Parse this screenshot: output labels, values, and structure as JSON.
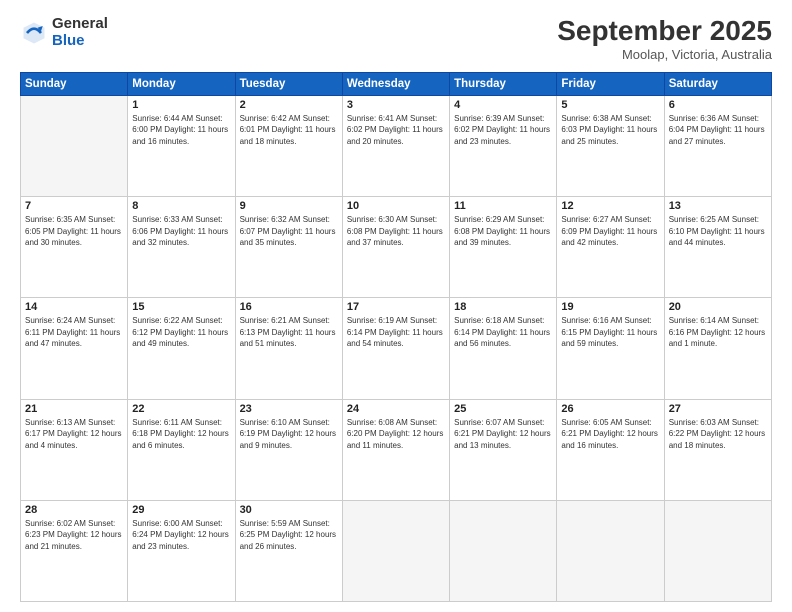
{
  "logo": {
    "general": "General",
    "blue": "Blue"
  },
  "header": {
    "month_title": "September 2025",
    "location": "Moolap, Victoria, Australia"
  },
  "weekdays": [
    "Sunday",
    "Monday",
    "Tuesday",
    "Wednesday",
    "Thursday",
    "Friday",
    "Saturday"
  ],
  "weeks": [
    [
      {
        "day": "",
        "info": ""
      },
      {
        "day": "1",
        "info": "Sunrise: 6:44 AM\nSunset: 6:00 PM\nDaylight: 11 hours\nand 16 minutes."
      },
      {
        "day": "2",
        "info": "Sunrise: 6:42 AM\nSunset: 6:01 PM\nDaylight: 11 hours\nand 18 minutes."
      },
      {
        "day": "3",
        "info": "Sunrise: 6:41 AM\nSunset: 6:02 PM\nDaylight: 11 hours\nand 20 minutes."
      },
      {
        "day": "4",
        "info": "Sunrise: 6:39 AM\nSunset: 6:02 PM\nDaylight: 11 hours\nand 23 minutes."
      },
      {
        "day": "5",
        "info": "Sunrise: 6:38 AM\nSunset: 6:03 PM\nDaylight: 11 hours\nand 25 minutes."
      },
      {
        "day": "6",
        "info": "Sunrise: 6:36 AM\nSunset: 6:04 PM\nDaylight: 11 hours\nand 27 minutes."
      }
    ],
    [
      {
        "day": "7",
        "info": "Sunrise: 6:35 AM\nSunset: 6:05 PM\nDaylight: 11 hours\nand 30 minutes."
      },
      {
        "day": "8",
        "info": "Sunrise: 6:33 AM\nSunset: 6:06 PM\nDaylight: 11 hours\nand 32 minutes."
      },
      {
        "day": "9",
        "info": "Sunrise: 6:32 AM\nSunset: 6:07 PM\nDaylight: 11 hours\nand 35 minutes."
      },
      {
        "day": "10",
        "info": "Sunrise: 6:30 AM\nSunset: 6:08 PM\nDaylight: 11 hours\nand 37 minutes."
      },
      {
        "day": "11",
        "info": "Sunrise: 6:29 AM\nSunset: 6:08 PM\nDaylight: 11 hours\nand 39 minutes."
      },
      {
        "day": "12",
        "info": "Sunrise: 6:27 AM\nSunset: 6:09 PM\nDaylight: 11 hours\nand 42 minutes."
      },
      {
        "day": "13",
        "info": "Sunrise: 6:25 AM\nSunset: 6:10 PM\nDaylight: 11 hours\nand 44 minutes."
      }
    ],
    [
      {
        "day": "14",
        "info": "Sunrise: 6:24 AM\nSunset: 6:11 PM\nDaylight: 11 hours\nand 47 minutes."
      },
      {
        "day": "15",
        "info": "Sunrise: 6:22 AM\nSunset: 6:12 PM\nDaylight: 11 hours\nand 49 minutes."
      },
      {
        "day": "16",
        "info": "Sunrise: 6:21 AM\nSunset: 6:13 PM\nDaylight: 11 hours\nand 51 minutes."
      },
      {
        "day": "17",
        "info": "Sunrise: 6:19 AM\nSunset: 6:14 PM\nDaylight: 11 hours\nand 54 minutes."
      },
      {
        "day": "18",
        "info": "Sunrise: 6:18 AM\nSunset: 6:14 PM\nDaylight: 11 hours\nand 56 minutes."
      },
      {
        "day": "19",
        "info": "Sunrise: 6:16 AM\nSunset: 6:15 PM\nDaylight: 11 hours\nand 59 minutes."
      },
      {
        "day": "20",
        "info": "Sunrise: 6:14 AM\nSunset: 6:16 PM\nDaylight: 12 hours\nand 1 minute."
      }
    ],
    [
      {
        "day": "21",
        "info": "Sunrise: 6:13 AM\nSunset: 6:17 PM\nDaylight: 12 hours\nand 4 minutes."
      },
      {
        "day": "22",
        "info": "Sunrise: 6:11 AM\nSunset: 6:18 PM\nDaylight: 12 hours\nand 6 minutes."
      },
      {
        "day": "23",
        "info": "Sunrise: 6:10 AM\nSunset: 6:19 PM\nDaylight: 12 hours\nand 9 minutes."
      },
      {
        "day": "24",
        "info": "Sunrise: 6:08 AM\nSunset: 6:20 PM\nDaylight: 12 hours\nand 11 minutes."
      },
      {
        "day": "25",
        "info": "Sunrise: 6:07 AM\nSunset: 6:21 PM\nDaylight: 12 hours\nand 13 minutes."
      },
      {
        "day": "26",
        "info": "Sunrise: 6:05 AM\nSunset: 6:21 PM\nDaylight: 12 hours\nand 16 minutes."
      },
      {
        "day": "27",
        "info": "Sunrise: 6:03 AM\nSunset: 6:22 PM\nDaylight: 12 hours\nand 18 minutes."
      }
    ],
    [
      {
        "day": "28",
        "info": "Sunrise: 6:02 AM\nSunset: 6:23 PM\nDaylight: 12 hours\nand 21 minutes."
      },
      {
        "day": "29",
        "info": "Sunrise: 6:00 AM\nSunset: 6:24 PM\nDaylight: 12 hours\nand 23 minutes."
      },
      {
        "day": "30",
        "info": "Sunrise: 5:59 AM\nSunset: 6:25 PM\nDaylight: 12 hours\nand 26 minutes."
      },
      {
        "day": "",
        "info": ""
      },
      {
        "day": "",
        "info": ""
      },
      {
        "day": "",
        "info": ""
      },
      {
        "day": "",
        "info": ""
      }
    ]
  ]
}
